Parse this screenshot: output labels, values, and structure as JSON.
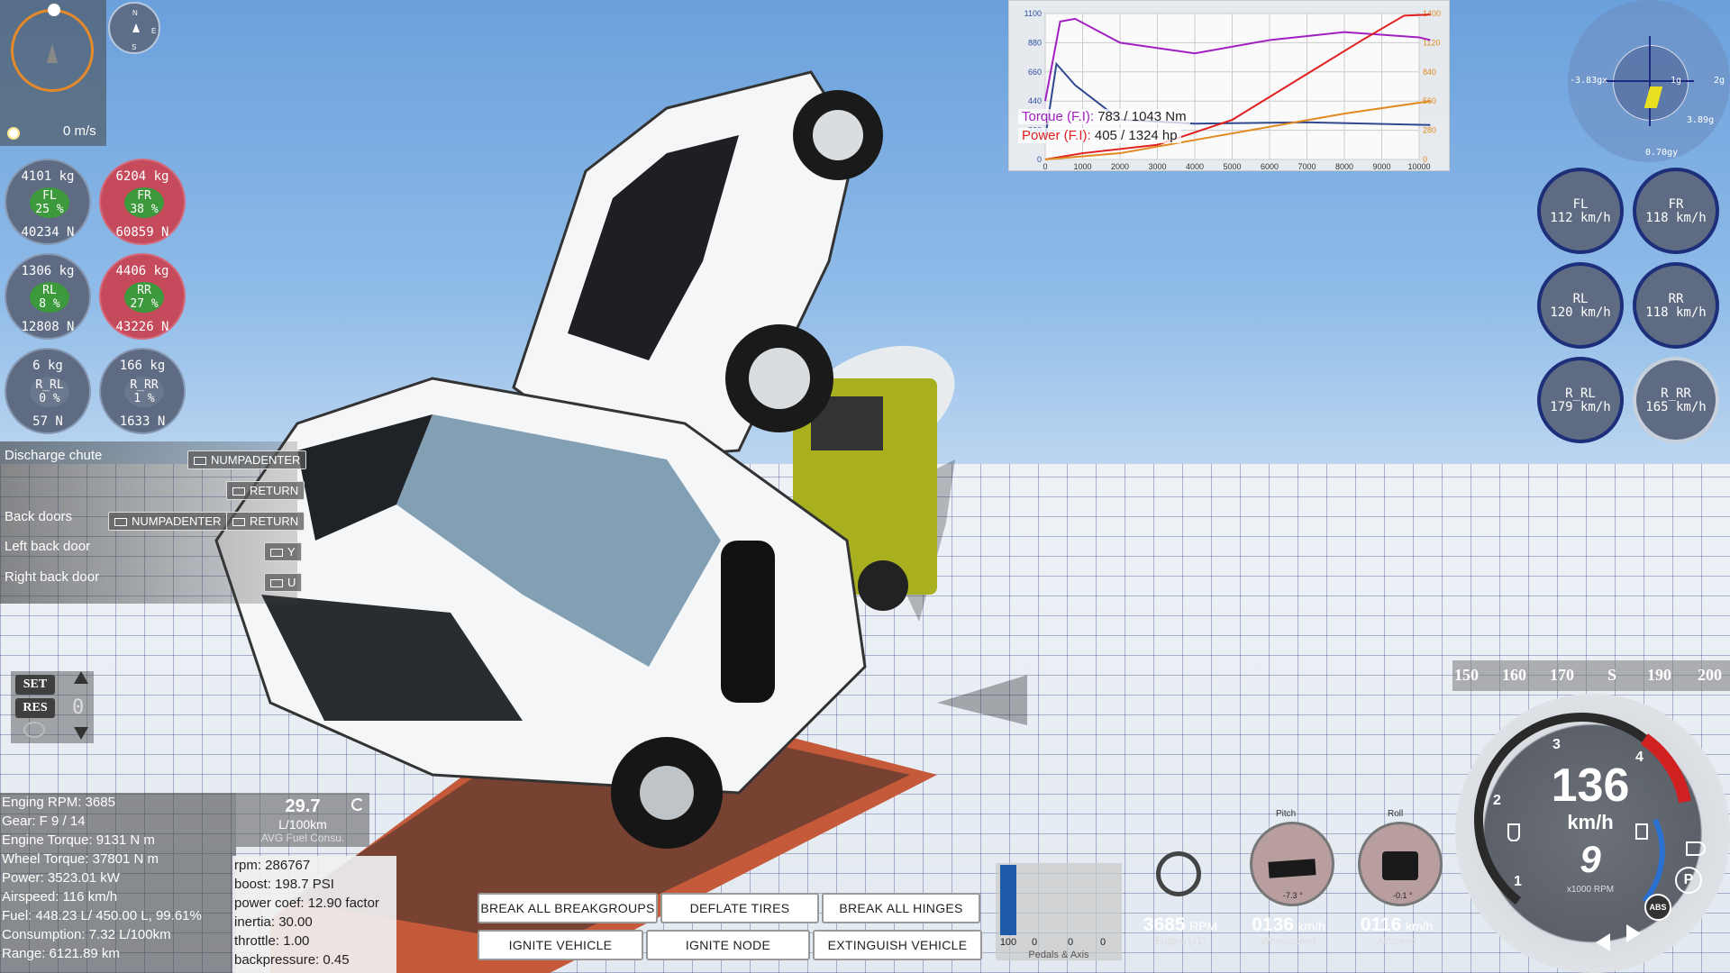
{
  "nav": {
    "speed": "0 m/s",
    "mini_compass": [
      "N",
      "E",
      "S"
    ]
  },
  "wheels_left": [
    {
      "id": "fl",
      "kg": "4101 kg",
      "name": "FL",
      "pct": "25 %",
      "force": "40234  N",
      "hot": false
    },
    {
      "id": "fr",
      "kg": "6204 kg",
      "name": "FR",
      "pct": "38 %",
      "force": "60859  N",
      "hot": true
    },
    {
      "id": "rl",
      "kg": "1306 kg",
      "name": "RL",
      "pct": "8 %",
      "force": "12808  N",
      "hot": false
    },
    {
      "id": "rr",
      "kg": "4406 kg",
      "name": "RR",
      "pct": "27 %",
      "force": "43226  N",
      "hot": true
    },
    {
      "id": "r_rl",
      "kg": "6 kg",
      "name": "R_RL",
      "pct": "0 %",
      "force": "57  N",
      "hot": false
    },
    {
      "id": "r_rr",
      "kg": "166 kg",
      "name": "R_RR",
      "pct": "1 %",
      "force": "1633  N",
      "hot": false
    }
  ],
  "wheels_right": [
    {
      "name": "FL",
      "speed": "112 km/h"
    },
    {
      "name": "FR",
      "speed": "118 km/h"
    },
    {
      "name": "RL",
      "speed": "120 km/h"
    },
    {
      "name": "RR",
      "speed": "118 km/h"
    },
    {
      "name": "R_RL",
      "speed": "179 km/h"
    },
    {
      "name": "R_RR",
      "speed": "165 km/h"
    }
  ],
  "gmeter": {
    "left": "-3.83gx",
    "mid": "1g",
    "right": "2g",
    "lower": "3.89g",
    "bottom": "0.70gy"
  },
  "graph": {
    "torque_label": "Torque (F.I):",
    "torque_value": "783 / 1043 Nm",
    "power_label": "Power (F.I):",
    "power_value": "405 / 1324 hp",
    "y_left": [
      "1100",
      "880",
      "660",
      "440",
      "220",
      "0"
    ],
    "y_right": [
      "1400",
      "1120",
      "840",
      "560",
      "280",
      "0"
    ],
    "x_ticks": [
      "0",
      "1000",
      "2000",
      "3000",
      "4000",
      "5000",
      "6000",
      "7000",
      "8000",
      "9000",
      "10000"
    ],
    "colors": {
      "torque": "#a020c0",
      "power": "#e02020",
      "torque_base": "#304890",
      "power_base": "#e08a20"
    }
  },
  "actions": {
    "discharge_chute": "Discharge chute",
    "back_doors": "Back doors",
    "left_back_door": "Left back door",
    "right_back_door": "Right back door",
    "key_numpadenter": "NUMPADENTER",
    "key_return": "RETURN",
    "key_y": "Y",
    "key_u": "U"
  },
  "cruise": {
    "set": "SET",
    "res": "RES",
    "value": "0"
  },
  "stats": [
    "Enging RPM: 3685",
    "Gear: F 9 / 14",
    "Engine Torque: 9131 N m",
    "Wheel Torque: 37801 N m",
    "Power: 3523.01 kW",
    "Airspeed: 116 km/h",
    "Fuel: 448.23 L/ 450.00 L, 99.61%",
    "Consumption: 7.32 L/100km",
    "Range: 6121.89 km"
  ],
  "fuel": {
    "value": "29.7",
    "unit": "L/100km",
    "label": "AVG Fuel Consu."
  },
  "engine_debug": [
    "rpm: 286767",
    "boost: 198.7 PSI",
    "power coef: 12.90 factor",
    "inertia: 30.00",
    "throttle: 1.00",
    "backpressure: 0.45"
  ],
  "buttons": {
    "break_breakgroups": "BREAK ALL BREAKGROUPS",
    "deflate_tires": "DEFLATE TIRES",
    "break_hinges": "BREAK ALL HINGES",
    "ignite_vehicle": "IGNITE VEHICLE",
    "ignite_node": "IGNITE NODE",
    "extinguish_vehicle": "EXTINGUISH VEHICLE"
  },
  "pedals": {
    "values": [
      "100",
      "0",
      "0",
      "0"
    ],
    "label": "Pedals & Axis",
    "throttle_fill": 1.0
  },
  "bottom": {
    "engine_value": "3685",
    "engine_unit": "RPM",
    "engine_label": "Engine (x1)",
    "wheel_value": "0136",
    "wheel_unit": "km/h",
    "wheel_label": "Wheelspeed",
    "air_value": "0116",
    "air_unit": "km/h",
    "air_label": "Airspeed"
  },
  "attitude": {
    "pitch_label": "Pitch",
    "pitch_value": "-7.3 °",
    "roll_label": "Roll",
    "roll_value": "-0.1 °"
  },
  "speedo": {
    "speed": "136",
    "unit": "km/h",
    "gear": "9",
    "rpm_label": "x1000 RPM",
    "rpm_marks": [
      "1",
      "2",
      "3",
      "4"
    ],
    "tape": [
      "150",
      "160",
      "170",
      "S",
      "190",
      "200"
    ],
    "abs": "ABS",
    "park": "P"
  }
}
